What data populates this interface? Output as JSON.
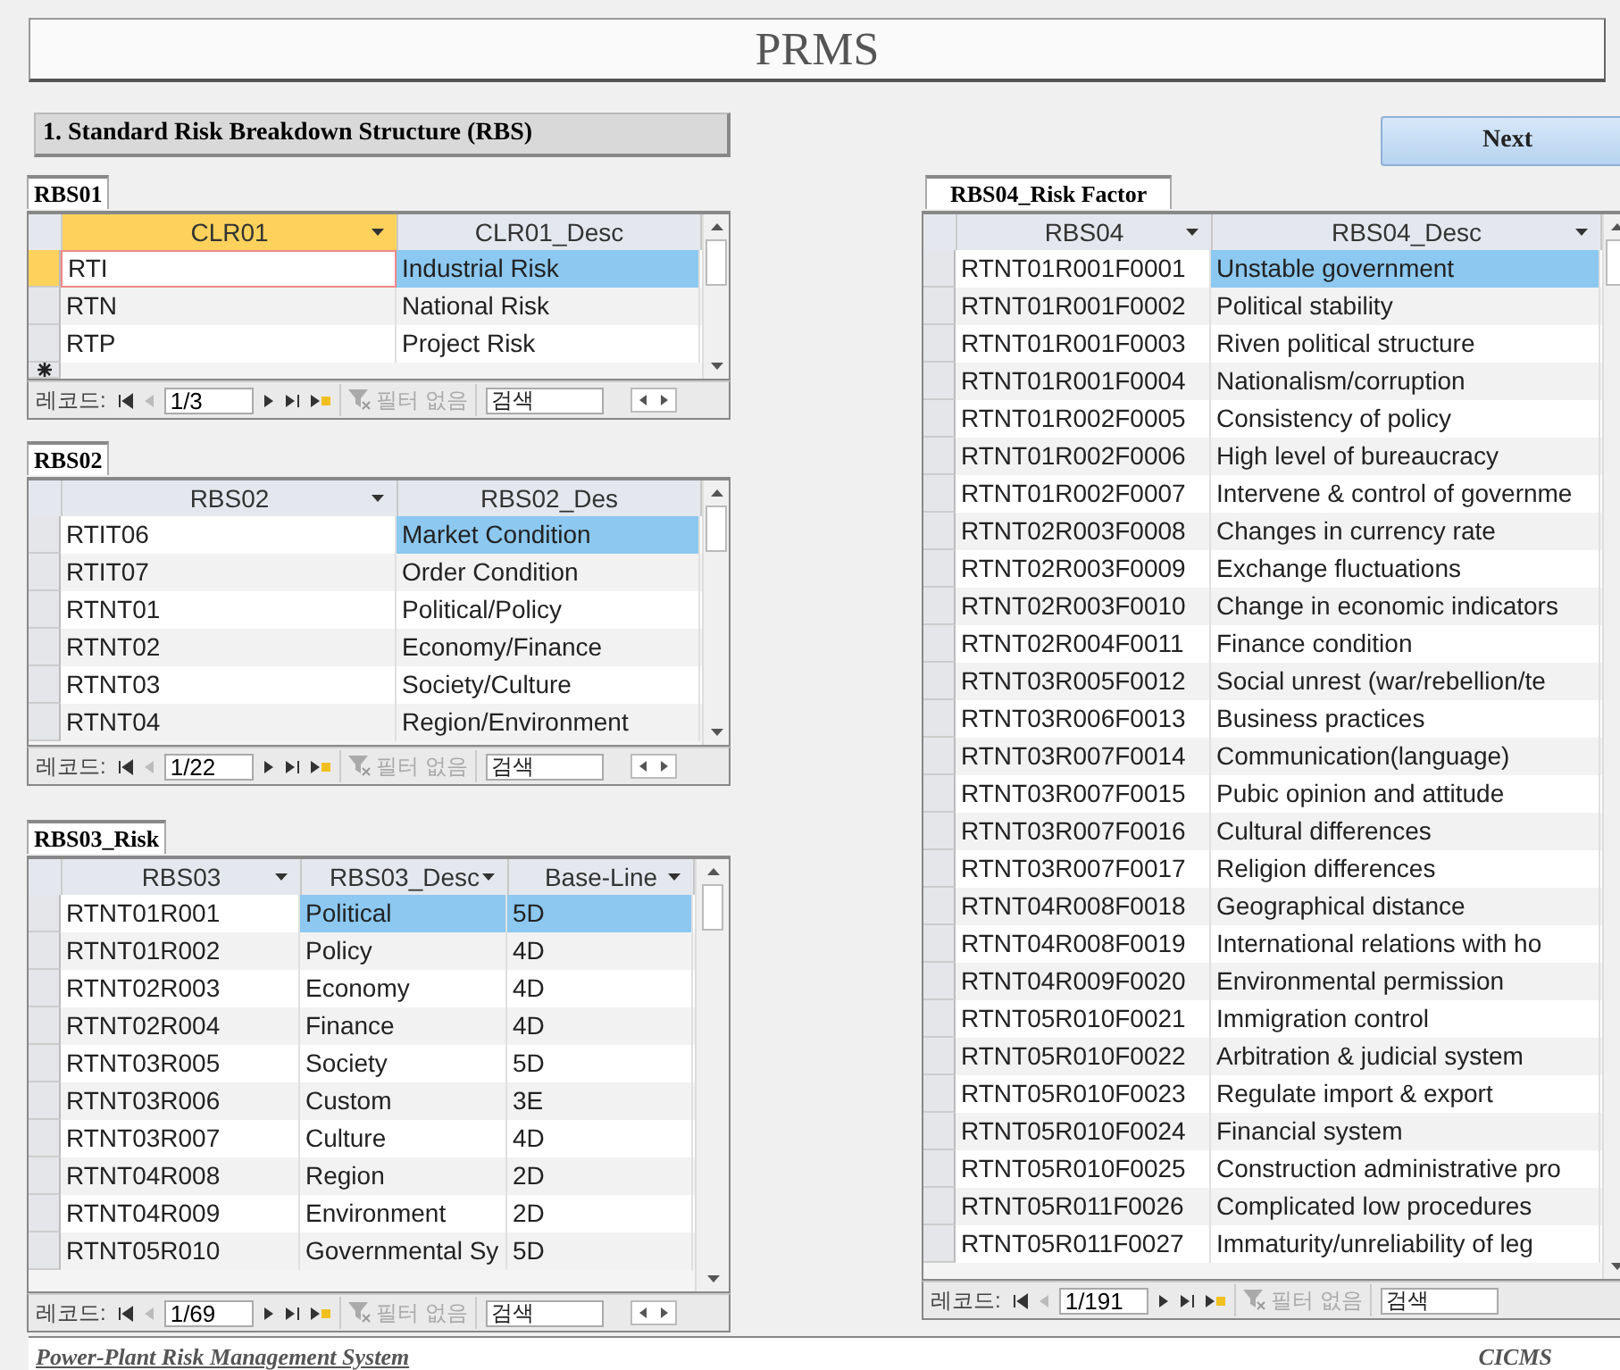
{
  "title": "PRMS",
  "section_title": "1. Standard Risk Breakdown Structure (RBS)",
  "next_button": "Next",
  "subforms": [
    {
      "label": "RBS01",
      "active": true,
      "new_record_row": true,
      "hscroll": true,
      "nav_label": "레코드:",
      "record": "1/3",
      "filter": "필터 없음",
      "search_placeholder": "검색",
      "columns": [
        {
          "name": "CLR01",
          "filter_arrow": true
        },
        {
          "name": "CLR01_Desc",
          "filter_arrow": false
        }
      ],
      "rows": [
        {
          "cells": [
            "RTI",
            "Industrial Risk"
          ],
          "selected": true
        },
        {
          "cells": [
            "RTN",
            "National Risk"
          ],
          "selected": false
        },
        {
          "cells": [
            "RTP",
            "Project Risk"
          ],
          "selected": false
        }
      ]
    },
    {
      "label": "RBS02",
      "active": false,
      "new_record_row": false,
      "hscroll": true,
      "nav_label": "레코드:",
      "record": "1/22",
      "filter": "필터 없음",
      "search_placeholder": "검색",
      "columns": [
        {
          "name": "RBS02",
          "filter_arrow": true
        },
        {
          "name": "RBS02_Des",
          "filter_arrow": false
        }
      ],
      "rows": [
        {
          "cells": [
            "RTIT06",
            "Market Condition"
          ],
          "selected": true
        },
        {
          "cells": [
            "RTIT07",
            "Order Condition"
          ],
          "selected": false
        },
        {
          "cells": [
            "RTNT01",
            "Political/Policy"
          ],
          "selected": false
        },
        {
          "cells": [
            "RTNT02",
            "Economy/Finance"
          ],
          "selected": false
        },
        {
          "cells": [
            "RTNT03",
            "Society/Culture"
          ],
          "selected": false
        },
        {
          "cells": [
            "RTNT04",
            "Region/Environment"
          ],
          "selected": false
        }
      ]
    },
    {
      "label": "RBS03_Risk",
      "active": false,
      "new_record_row": false,
      "hscroll": true,
      "nav_label": "레코드:",
      "record": "1/69",
      "filter": "필터 없음",
      "search_placeholder": "검색",
      "columns": [
        {
          "name": "RBS03",
          "filter_arrow": true
        },
        {
          "name": "RBS03_Desc",
          "filter_arrow": true
        },
        {
          "name": "Base-Line",
          "filter_arrow": true
        }
      ],
      "rows": [
        {
          "cells": [
            "RTNT01R001",
            "Political",
            "5D"
          ],
          "selected": true
        },
        {
          "cells": [
            "RTNT01R002",
            "Policy",
            "4D"
          ],
          "selected": false
        },
        {
          "cells": [
            "RTNT02R003",
            "Economy",
            "4D"
          ],
          "selected": false
        },
        {
          "cells": [
            "RTNT02R004",
            "Finance",
            "4D"
          ],
          "selected": false
        },
        {
          "cells": [
            "RTNT03R005",
            "Society",
            "5D"
          ],
          "selected": false
        },
        {
          "cells": [
            "RTNT03R006",
            "Custom",
            "3E"
          ],
          "selected": false
        },
        {
          "cells": [
            "RTNT03R007",
            "Culture",
            "4D"
          ],
          "selected": false
        },
        {
          "cells": [
            "RTNT04R008",
            "Region",
            "2D"
          ],
          "selected": false
        },
        {
          "cells": [
            "RTNT04R009",
            "Environment",
            "2D"
          ],
          "selected": false
        },
        {
          "cells": [
            "RTNT05R010",
            "Governmental Sy",
            "5D"
          ],
          "selected": false
        }
      ]
    },
    {
      "label": "RBS04_Risk Factor",
      "active": false,
      "new_record_row": false,
      "hscroll": false,
      "nav_label": "레코드:",
      "record": "1/191",
      "filter": "필터 없음",
      "search_placeholder": "검색",
      "columns": [
        {
          "name": "RBS04",
          "filter_arrow": true
        },
        {
          "name": "RBS04_Desc",
          "filter_arrow": true
        }
      ],
      "rows": [
        {
          "cells": [
            "RTNT01R001F0001",
            "Unstable government"
          ],
          "selected": true
        },
        {
          "cells": [
            "RTNT01R001F0002",
            "Political stability"
          ],
          "selected": false
        },
        {
          "cells": [
            "RTNT01R001F0003",
            "Riven political structure"
          ],
          "selected": false
        },
        {
          "cells": [
            "RTNT01R001F0004",
            "Nationalism/corruption"
          ],
          "selected": false
        },
        {
          "cells": [
            "RTNT01R002F0005",
            "Consistency of policy"
          ],
          "selected": false
        },
        {
          "cells": [
            "RTNT01R002F0006",
            "High level of bureaucracy"
          ],
          "selected": false
        },
        {
          "cells": [
            "RTNT01R002F0007",
            "Intervene & control of governme"
          ],
          "selected": false
        },
        {
          "cells": [
            "RTNT02R003F0008",
            "Changes in currency rate"
          ],
          "selected": false
        },
        {
          "cells": [
            "RTNT02R003F0009",
            "Exchange fluctuations"
          ],
          "selected": false
        },
        {
          "cells": [
            "RTNT02R003F0010",
            "Change in economic indicators"
          ],
          "selected": false
        },
        {
          "cells": [
            "RTNT02R004F0011",
            "Finance condition"
          ],
          "selected": false
        },
        {
          "cells": [
            "RTNT03R005F0012",
            "Social unrest (war/rebellion/te"
          ],
          "selected": false
        },
        {
          "cells": [
            "RTNT03R006F0013",
            "Business practices"
          ],
          "selected": false
        },
        {
          "cells": [
            "RTNT03R007F0014",
            "Communication(language)"
          ],
          "selected": false
        },
        {
          "cells": [
            "RTNT03R007F0015",
            "Pubic opinion and attitude"
          ],
          "selected": false
        },
        {
          "cells": [
            "RTNT03R007F0016",
            "Cultural differences"
          ],
          "selected": false
        },
        {
          "cells": [
            "RTNT03R007F0017",
            "Religion differences"
          ],
          "selected": false
        },
        {
          "cells": [
            "RTNT04R008F0018",
            "Geographical distance"
          ],
          "selected": false
        },
        {
          "cells": [
            "RTNT04R008F0019",
            "International relations with ho"
          ],
          "selected": false
        },
        {
          "cells": [
            "RTNT04R009F0020",
            "Environmental permission"
          ],
          "selected": false
        },
        {
          "cells": [
            "RTNT05R010F0021",
            "Immigration control"
          ],
          "selected": false
        },
        {
          "cells": [
            "RTNT05R010F0022",
            "Arbitration & judicial system"
          ],
          "selected": false
        },
        {
          "cells": [
            "RTNT05R010F0023",
            "Regulate import & export"
          ],
          "selected": false
        },
        {
          "cells": [
            "RTNT05R010F0024",
            "Financial system"
          ],
          "selected": false
        },
        {
          "cells": [
            "RTNT05R010F0025",
            "Construction administrative pro"
          ],
          "selected": false
        },
        {
          "cells": [
            "RTNT05R011F0026",
            "Complicated low procedures"
          ],
          "selected": false
        },
        {
          "cells": [
            "RTNT05R011F0027",
            "Immaturity/unreliability of leg"
          ],
          "selected": false
        }
      ]
    }
  ],
  "footer": {
    "left": "Power-Plant Risk Management System",
    "right": "CICMS"
  }
}
